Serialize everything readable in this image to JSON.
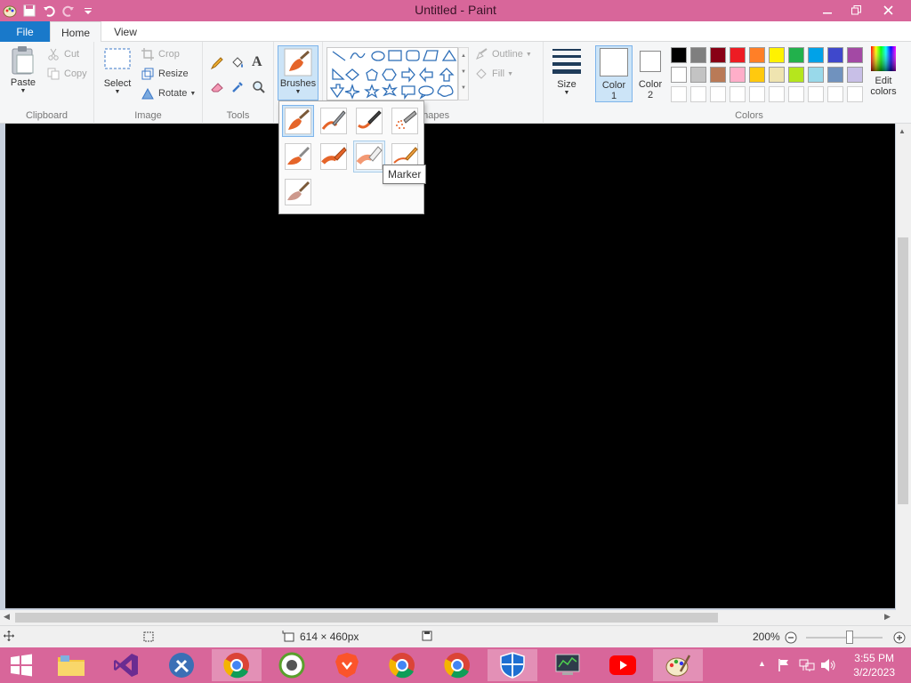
{
  "window": {
    "title": "Untitled - Paint",
    "minimize_icon": "minimize-icon",
    "restore_icon": "restore-icon",
    "close_icon": "close-icon"
  },
  "tabs": {
    "file": "File",
    "home": "Home",
    "view": "View"
  },
  "ribbon": {
    "clipboard": {
      "label": "Clipboard",
      "paste": "Paste",
      "cut": "Cut",
      "copy": "Copy"
    },
    "image": {
      "label": "Image",
      "select": "Select",
      "crop": "Crop",
      "resize": "Resize",
      "rotate": "Rotate"
    },
    "tools": {
      "label": "Tools"
    },
    "brushes": {
      "label": "Brushes"
    },
    "shapes": {
      "label": "Shapes",
      "outline": "Outline",
      "fill": "Fill"
    },
    "size": {
      "label": "Size"
    },
    "color1": {
      "label": "Color",
      "num": "1"
    },
    "color2": {
      "label": "Color",
      "num": "2"
    },
    "colors": {
      "label": "Colors",
      "edit_line1": "Edit",
      "edit_line2": "colors",
      "row1": [
        "#000000",
        "#7f7f7f",
        "#880015",
        "#ed1c24",
        "#ff7f27",
        "#fff200",
        "#22b14c",
        "#00a2e8",
        "#3f48cc",
        "#a349a4"
      ],
      "row2": [
        "#ffffff",
        "#c3c3c3",
        "#b97a57",
        "#ffaec9",
        "#ffc90e",
        "#efe4b0",
        "#b5e61d",
        "#99d9ea",
        "#7092be",
        "#c8bfe7"
      ]
    }
  },
  "brushes_dropdown": {
    "tooltip": "Marker"
  },
  "status": {
    "dimensions": "614 × 460px",
    "zoom": "200%"
  },
  "taskbar": {
    "time": "3:55 PM",
    "date": "3/2/2023"
  }
}
